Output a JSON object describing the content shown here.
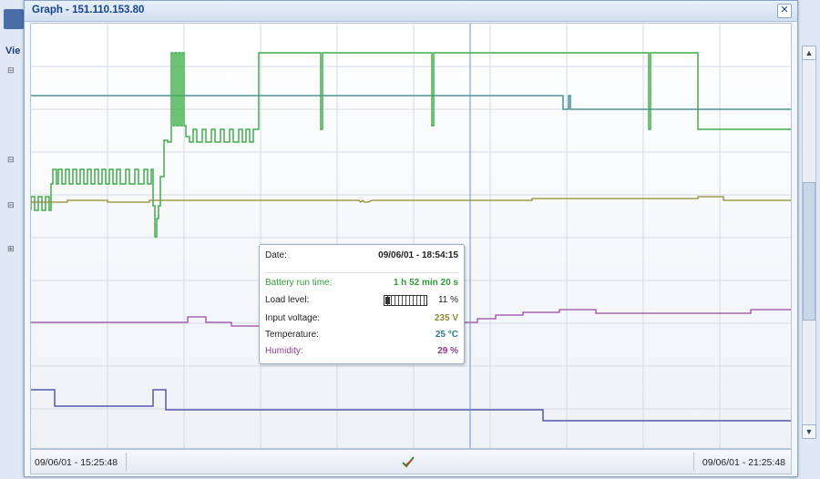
{
  "window": {
    "title": "Graph - 151.110.153.80"
  },
  "background": {
    "menu_label": "Vie"
  },
  "footer": {
    "start_time": "09/06/01 - 15:25:48",
    "end_time": "09/06/01 - 21:25:48",
    "tool_icon": "pencil-check-icon"
  },
  "tooltip": {
    "date_label": "Date:",
    "date_value": "09/06/01 - 18:54:15",
    "battery_label": "Battery run time:",
    "battery_value": "1 h 52 min 20 s",
    "load_label": "Load level:",
    "load_value": "11 %",
    "load_fraction": 0.11,
    "voltage_label": "Input voltage:",
    "voltage_value": "235 V",
    "temp_label": "Temperature:",
    "temp_value": "25 °C",
    "humidity_label": "Humidity:",
    "humidity_value": "29 %"
  },
  "colors": {
    "battery": "#3fae49",
    "load": "#2a7f86",
    "voltage": "#8f8a32",
    "temperature": "#5657b0",
    "humidity": "#9a4aa3",
    "title": "#15428b",
    "cursor_line": "#6d8fd0"
  }
}
